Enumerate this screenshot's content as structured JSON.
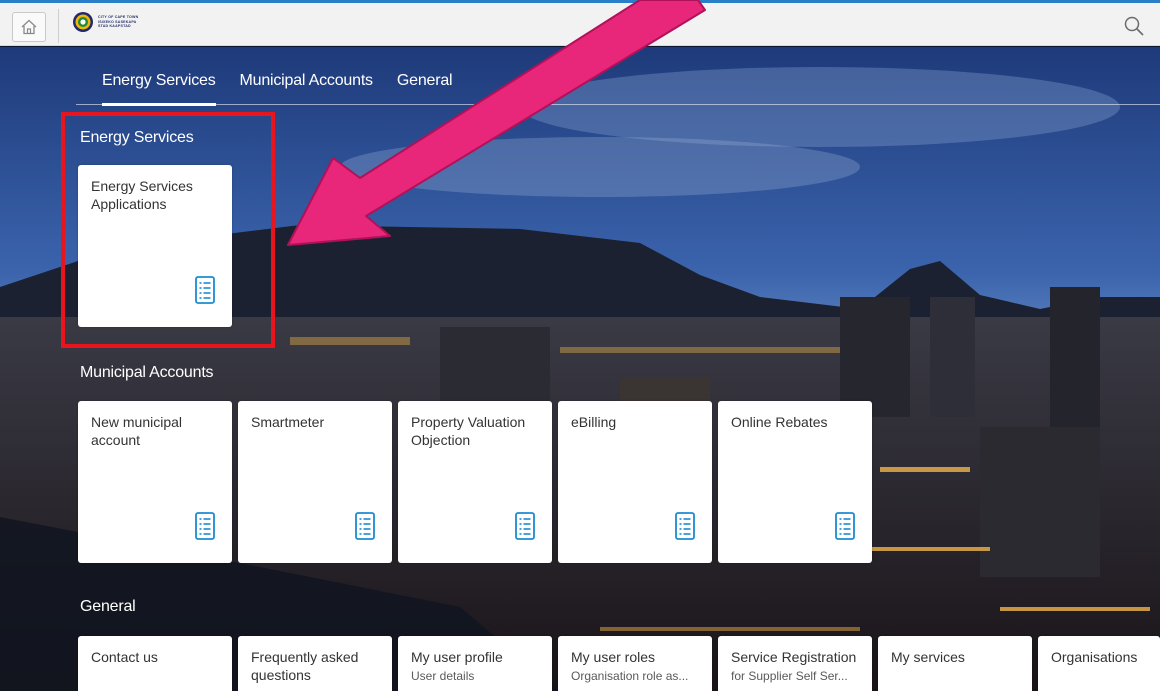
{
  "shell": {
    "logo_lines": [
      "CITY OF CAPE TOWN",
      "ISIXEKO SASEKAPA",
      "STAD KAAPSTAD"
    ],
    "icons": {
      "home": "home-icon",
      "search": "search-icon",
      "logo": "city-logo-icon"
    },
    "accent_color": "#2a7fc9"
  },
  "tabs": [
    {
      "label": "Energy Services",
      "active": true
    },
    {
      "label": "Municipal Accounts",
      "active": false
    },
    {
      "label": "General",
      "active": false
    }
  ],
  "groups": {
    "energy": {
      "title": "Energy Services",
      "tiles": [
        {
          "title": "Energy Services Applications"
        }
      ]
    },
    "municipal": {
      "title": "Municipal Accounts",
      "tiles": [
        {
          "title": "New municipal account"
        },
        {
          "title": "Smartmeter"
        },
        {
          "title": "Property Valuation Objection"
        },
        {
          "title": "eBilling"
        },
        {
          "title": "Online Rebates"
        }
      ]
    },
    "general": {
      "title": "General",
      "tiles": [
        {
          "title": "Contact us",
          "subtitle": ""
        },
        {
          "title": "Frequently asked questions",
          "subtitle": ""
        },
        {
          "title": "My user profile",
          "subtitle": "User details"
        },
        {
          "title": "My user roles",
          "subtitle": "Organisation role as..."
        },
        {
          "title": "Service Registration",
          "subtitle": "for Supplier Self Ser..."
        },
        {
          "title": "My services",
          "subtitle": ""
        },
        {
          "title": "Organisations",
          "subtitle": ""
        }
      ]
    }
  },
  "tile_icon": "list-document-icon",
  "annotation": {
    "highlight_color": "#e8141e",
    "arrow_color": "#e8267a"
  }
}
